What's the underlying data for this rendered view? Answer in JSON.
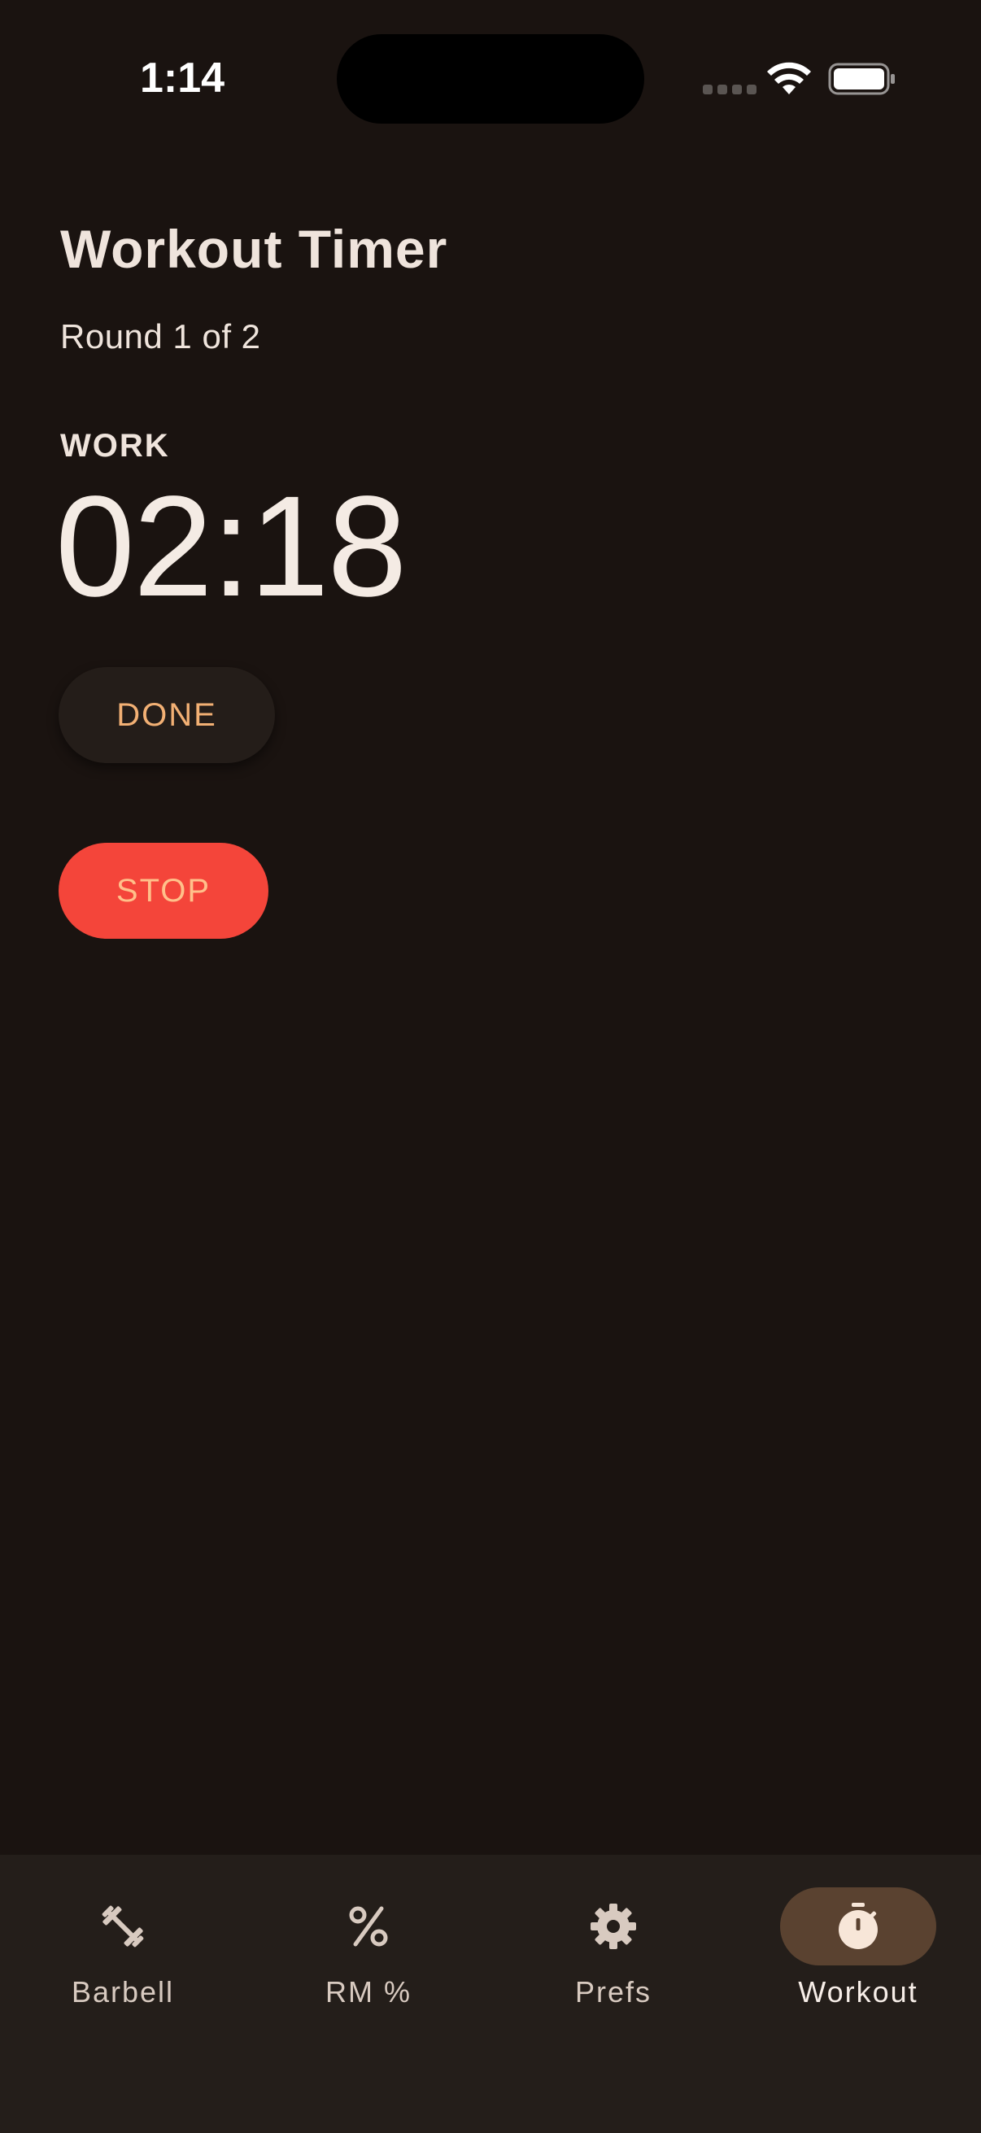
{
  "status_bar": {
    "time": "1:14"
  },
  "header": {
    "title": "Workout Timer",
    "round": "Round 1 of 2"
  },
  "timer": {
    "phase": "WORK",
    "time": "02:18"
  },
  "actions": {
    "done_label": "DONE",
    "stop_label": "STOP"
  },
  "nav": {
    "items": [
      {
        "label": "Barbell",
        "icon": "barbell-icon",
        "active": false
      },
      {
        "label": "RM %",
        "icon": "percent-icon",
        "active": false
      },
      {
        "label": "Prefs",
        "icon": "gear-icon",
        "active": false
      },
      {
        "label": "Workout",
        "icon": "stopwatch-icon",
        "active": true
      }
    ]
  },
  "colors": {
    "background": "#1a1310",
    "accent": "#f2b074",
    "stop": "#f4453a",
    "nav_background": "#241e1a",
    "nav_active_pill": "#5a4230"
  }
}
